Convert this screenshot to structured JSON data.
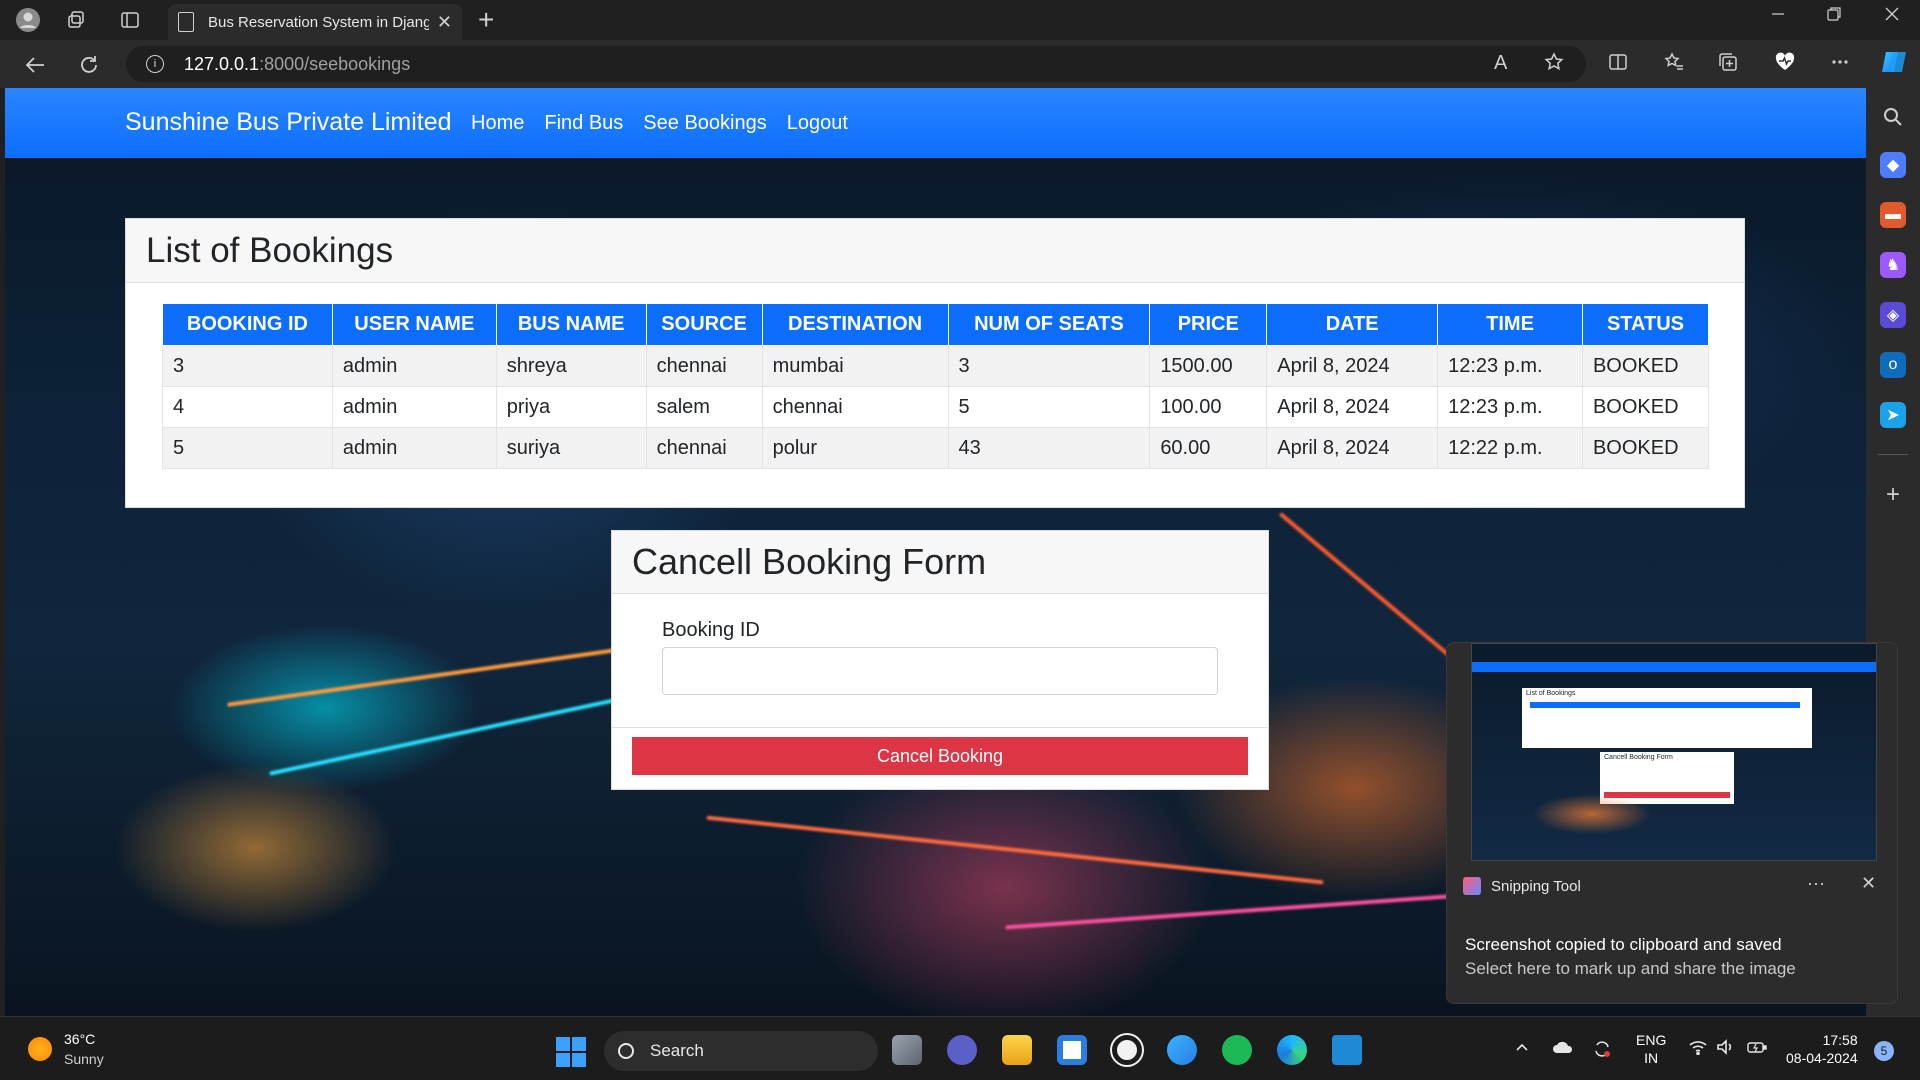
{
  "browser": {
    "tab_title": "Bus Reservation System in Djang",
    "url_host": "127.0.0.1",
    "url_path": ":8000/seebookings",
    "new_tab_symbol": "+",
    "close_symbol": "✕",
    "read_aloud_label": "A"
  },
  "navbar": {
    "brand": "Sunshine Bus Private Limited",
    "links": [
      "Home",
      "Find Bus",
      "See Bookings",
      "Logout"
    ],
    "color": "#0d6efd"
  },
  "bookings": {
    "heading": "List of Bookings",
    "columns": [
      "BOOKING ID",
      "USER NAME",
      "BUS NAME",
      "SOURCE",
      "DESTINATION",
      "NUM OF SEATS",
      "PRICE",
      "DATE",
      "TIME",
      "STATUS"
    ],
    "rows": [
      [
        "3",
        "admin",
        "shreya",
        "chennai",
        "mumbai",
        "3",
        "1500.00",
        "April 8, 2024",
        "12:23 p.m.",
        "BOOKED"
      ],
      [
        "4",
        "admin",
        "priya",
        "salem",
        "chennai",
        "5",
        "100.00",
        "April 8, 2024",
        "12:23 p.m.",
        "BOOKED"
      ],
      [
        "5",
        "admin",
        "suriya",
        "chennai",
        "polur",
        "43",
        "60.00",
        "April 8, 2024",
        "12:22 p.m.",
        "BOOKED"
      ]
    ]
  },
  "cancel_form": {
    "heading": "Cancell Booking Form",
    "field_label": "Booking ID",
    "field_value": "",
    "button_label": "Cancel Booking",
    "button_color": "#dc3545"
  },
  "toast": {
    "app_name": "Snipping Tool",
    "title": "Screenshot copied to clipboard and saved",
    "message": "Select here to mark up and share the image",
    "thumb_title": "List of Bookings",
    "thumb_form_title": "Cancell Booking Form",
    "more_symbol": "···",
    "close_symbol": "✕"
  },
  "taskbar": {
    "temperature": "36°C",
    "condition": "Sunny",
    "search_label": "Search",
    "lang_line1": "ENG",
    "lang_line2": "IN",
    "time": "17:58",
    "date": "08-04-2024",
    "notification_count": "5"
  }
}
